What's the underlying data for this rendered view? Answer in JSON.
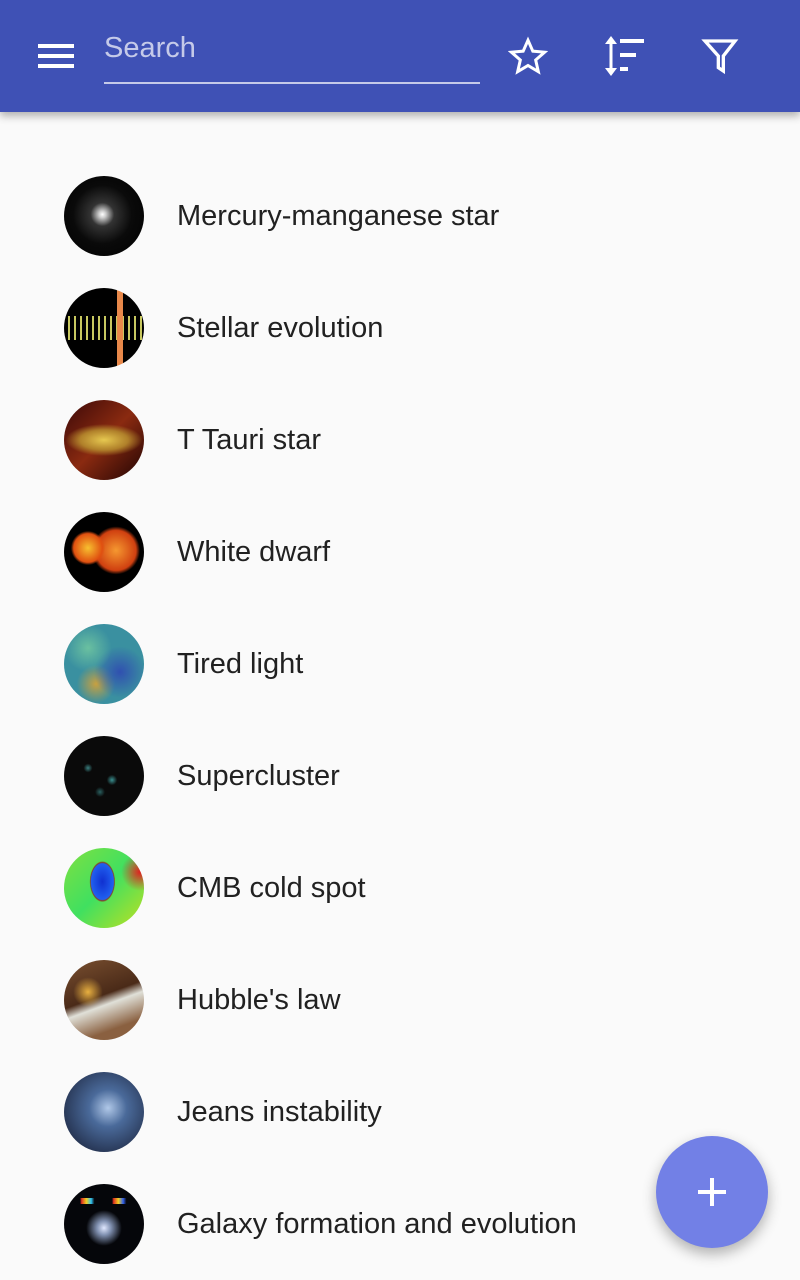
{
  "appbar": {
    "background": "#3f51b5",
    "menu_icon": "hamburger-menu-icon",
    "search": {
      "placeholder": "Search",
      "value": ""
    },
    "actions": [
      {
        "name": "favorites",
        "icon": "star-outline-icon"
      },
      {
        "name": "sort",
        "icon": "sort-icon"
      },
      {
        "name": "filter",
        "icon": "filter-icon"
      }
    ]
  },
  "list": {
    "items": [
      {
        "title": "Mercury-manganese star",
        "thumb": "dark star field with bright central star"
      },
      {
        "title": "Stellar evolution",
        "thumb": "row of colored stars on black"
      },
      {
        "title": "T Tauri star",
        "thumb": "orange protoplanetary disk"
      },
      {
        "title": "White dwarf",
        "thumb": "two orange suns on black"
      },
      {
        "title": "Tired light",
        "thumb": "blue-green microwave background map"
      },
      {
        "title": "Supercluster",
        "thumb": "dark map with cyan dots"
      },
      {
        "title": "CMB cold spot",
        "thumb": "rainbow temperature map with blue spot"
      },
      {
        "title": "Hubble's law",
        "thumb": "glass of beer and coins"
      },
      {
        "title": "Jeans instability",
        "thumb": "blue nebula with stars"
      },
      {
        "title": "Galaxy formation and evolution",
        "thumb": "galaxies with spectra on black"
      }
    ]
  },
  "fab": {
    "icon": "plus-icon",
    "color": "#7280e6"
  }
}
